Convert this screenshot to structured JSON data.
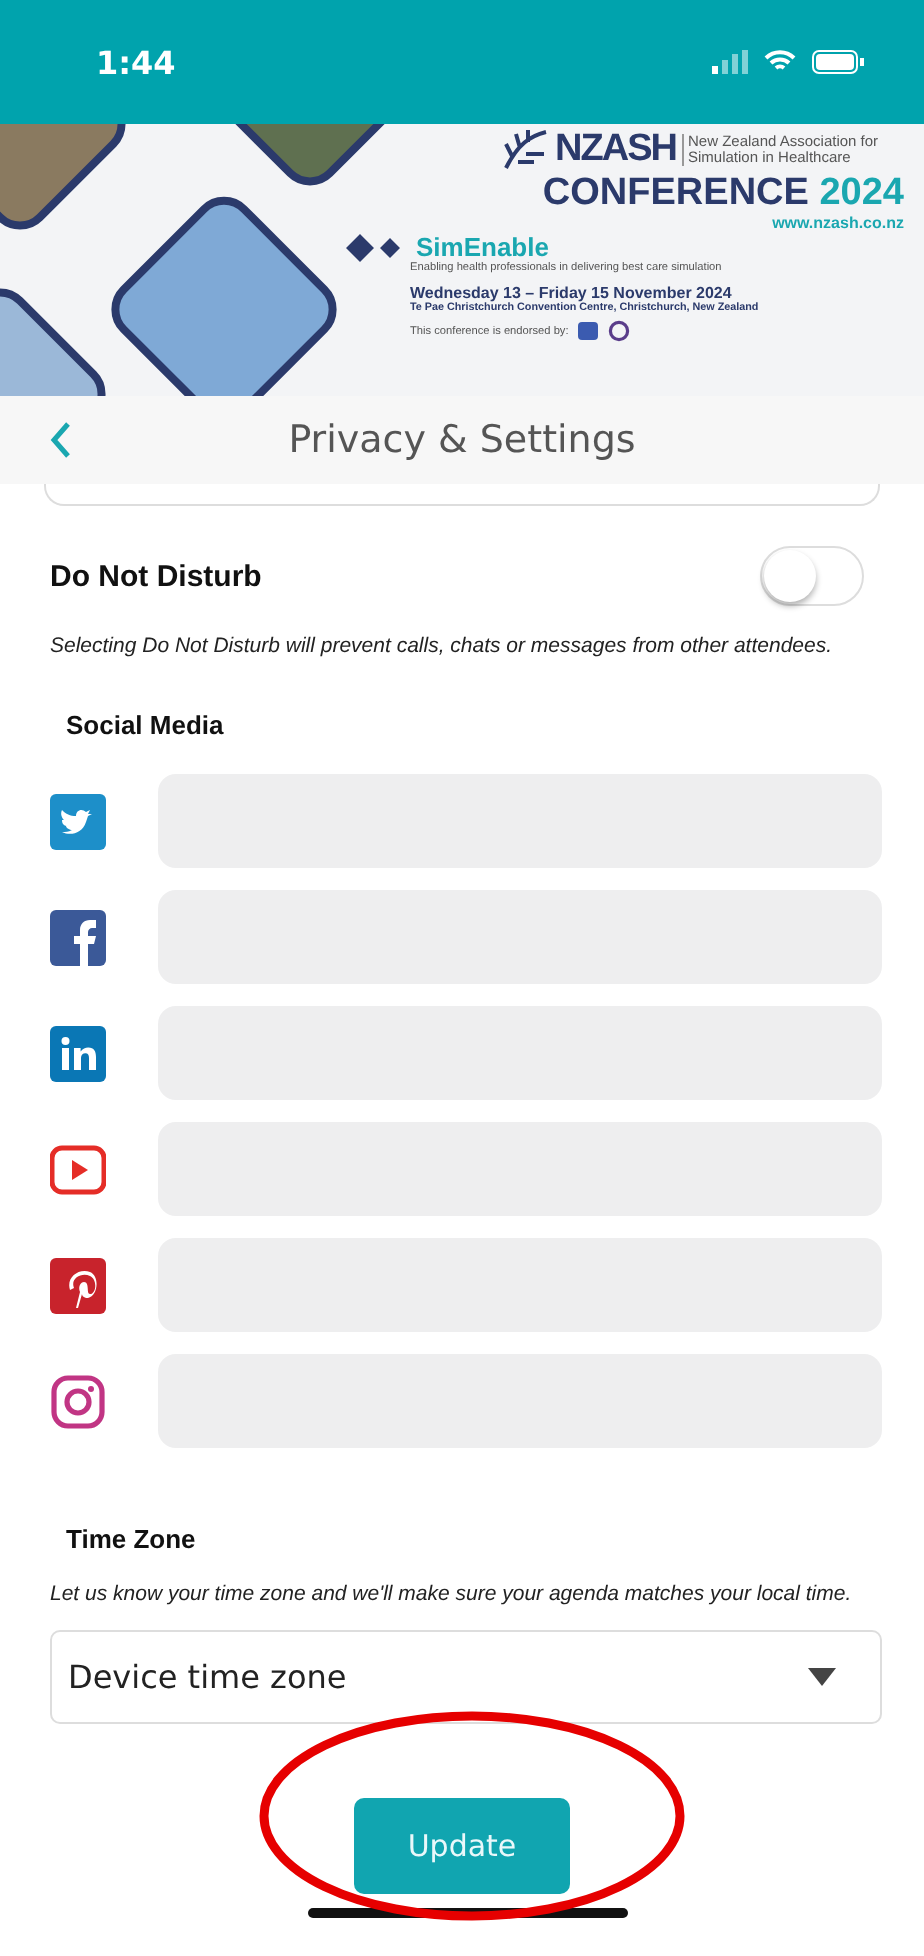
{
  "status_bar": {
    "time": "1:44"
  },
  "banner": {
    "org": "NZASH",
    "org_full": "New Zealand Association for Simulation in Healthcare",
    "title": "CONFERENCE",
    "year": "2024",
    "website": "www.nzash.co.nz",
    "theme": "SimEnable",
    "tagline": "Enabling health professionals in delivering best care simulation",
    "dates": "Wednesday 13 – Friday 15 November 2024",
    "venue": "Te Pae Christchurch Convention Centre, Christchurch, New Zealand",
    "endorsement": "This conference is endorsed by:"
  },
  "header": {
    "title": "Privacy & Settings"
  },
  "do_not_disturb": {
    "label": "Do Not Disturb",
    "on": false,
    "description": "Selecting Do Not Disturb will prevent calls, chats or messages from other attendees."
  },
  "social_media": {
    "heading": "Social Media",
    "accounts": [
      {
        "kind": "twitter"
      },
      {
        "kind": "facebook"
      },
      {
        "kind": "linkedin"
      },
      {
        "kind": "youtube"
      },
      {
        "kind": "pinterest"
      },
      {
        "kind": "instagram"
      }
    ]
  },
  "time_zone": {
    "heading": "Time Zone",
    "description": "Let us know your time zone and we'll make sure your agenda matches your local time.",
    "value": "Device time zone"
  },
  "update_button": {
    "label": "Update"
  },
  "highlight": {
    "kind": "ellipse"
  }
}
